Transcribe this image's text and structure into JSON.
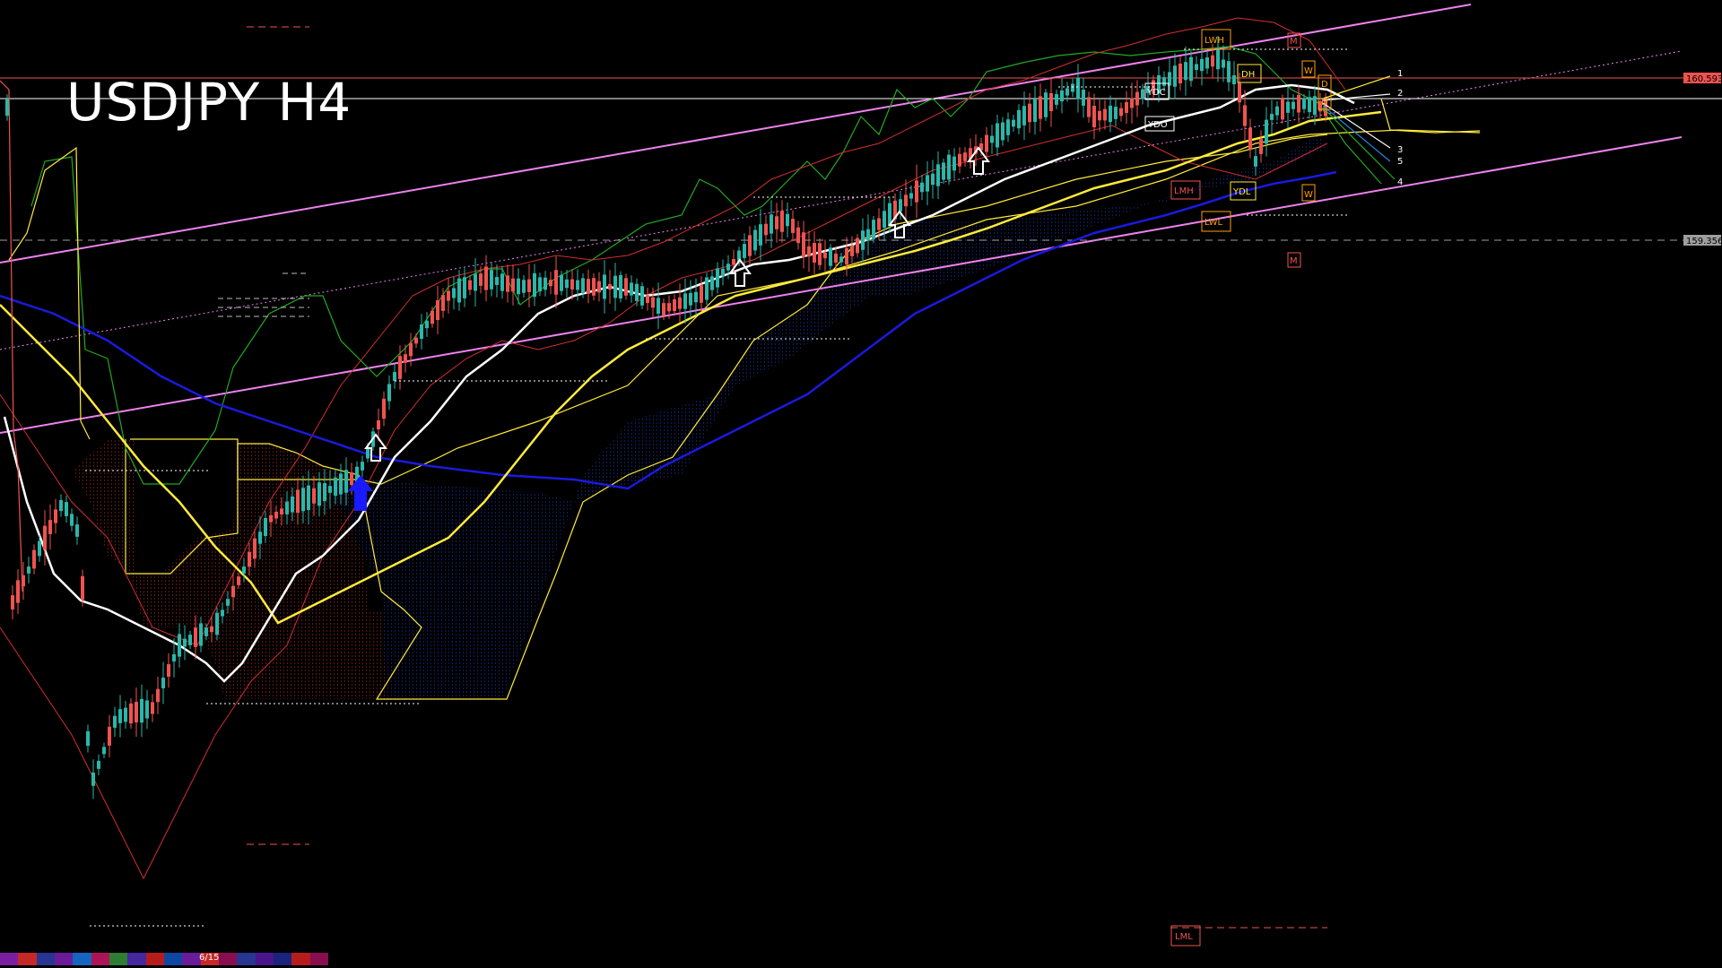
{
  "chart_title": "USDJPY H4",
  "chart_data": {
    "type": "line",
    "title": "USDJPY H4",
    "price_labels": [
      "160.593",
      "159.356"
    ],
    "level_numbers": [
      "1",
      "2",
      "3",
      "5",
      "4"
    ],
    "markers": [
      "LWH",
      "DH",
      "YDC",
      "YDO",
      "YDL",
      "LMH",
      "LWL",
      "LML",
      "M",
      "M",
      "W",
      "W",
      "D",
      "D"
    ],
    "bottom_label": "6/15"
  },
  "colors": {
    "background": "#000000",
    "bull_candle": "#2ab7a9",
    "bear_candle": "#ef5350",
    "ma_white": "#ffffff",
    "ma_yellow": "#ffeb3b",
    "ma_blue": "#1a1adf",
    "channel": "#ee82ee",
    "cloud_red": "#c62828",
    "cloud_blue": "#1e3cc8",
    "green_line": "#22aa22"
  }
}
